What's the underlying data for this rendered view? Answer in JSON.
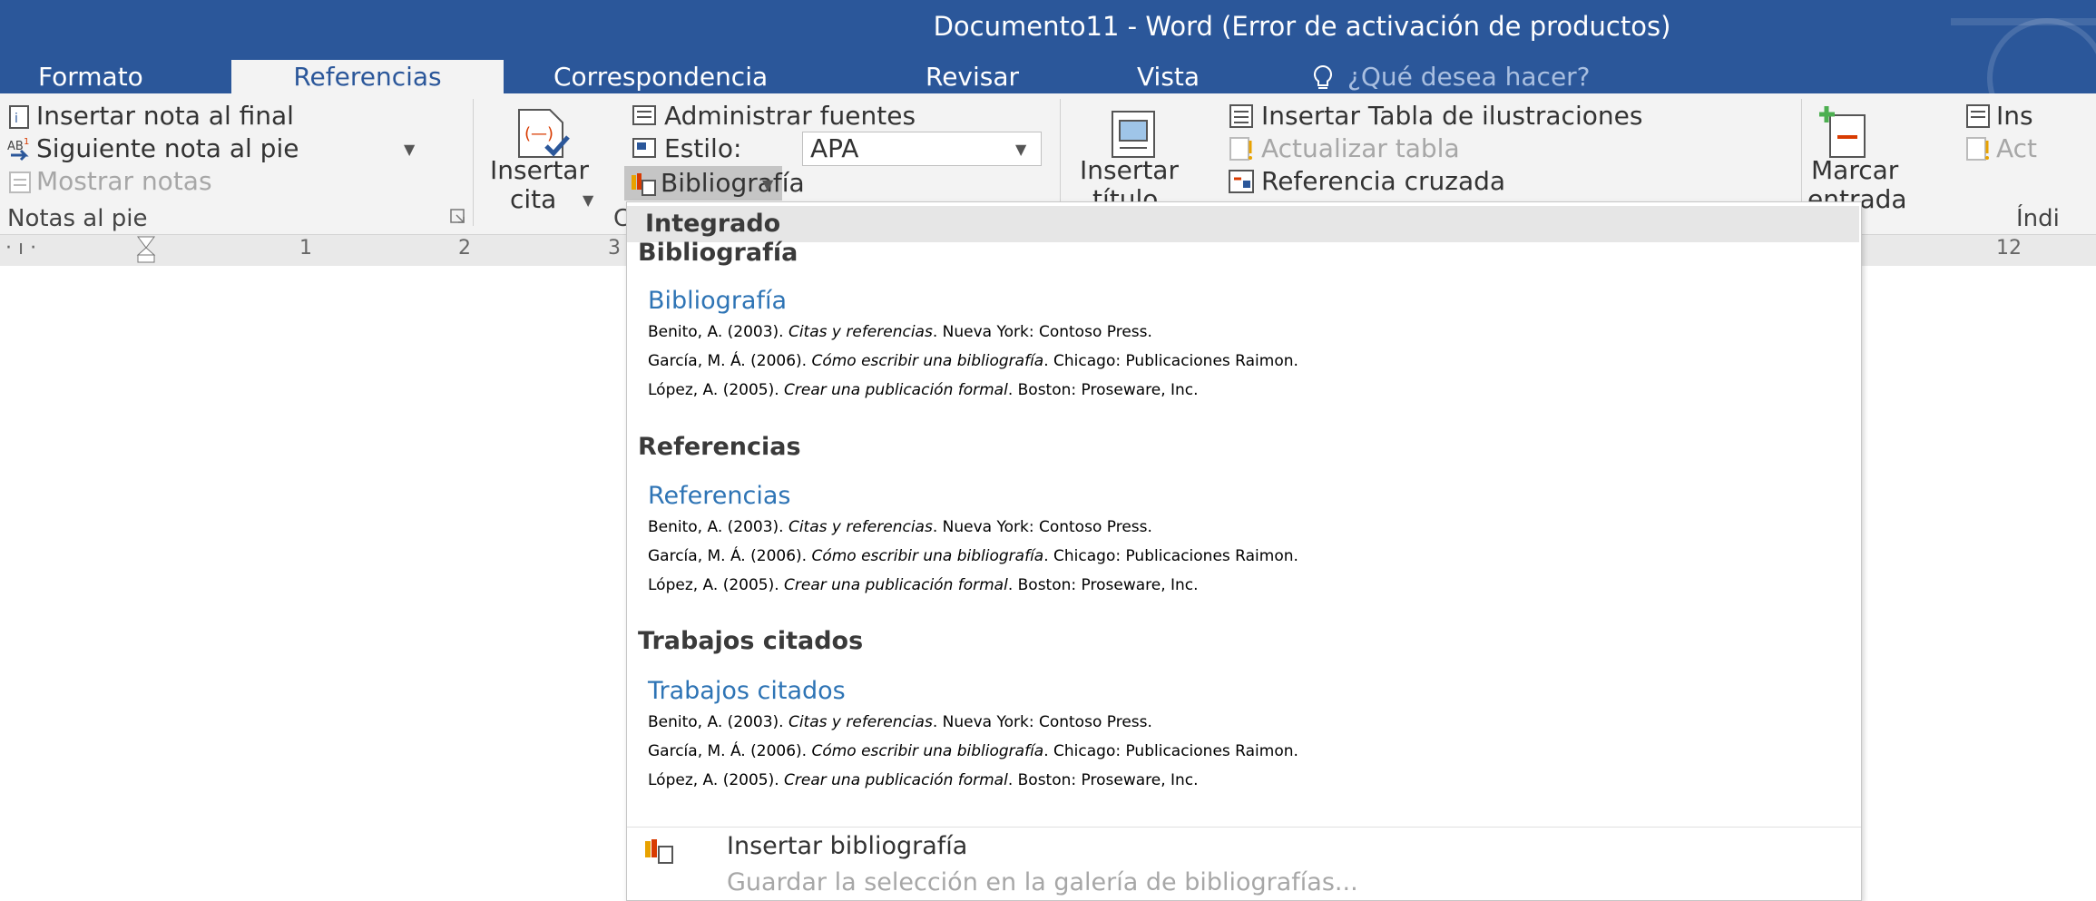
{
  "window": {
    "title": "Documento11 - Word (Error de activación de productos)"
  },
  "tabs": [
    "Formato",
    "Referencias",
    "Correspondencia",
    "Revisar",
    "Vista"
  ],
  "tell_me": "¿Qué desea hacer?",
  "ribbon": {
    "footnotes": {
      "insert_endnote": "Insertar nota al final",
      "next_footnote": "Siguiente nota al pie",
      "show_notes": "Mostrar notas",
      "group_label": "Notas al pie"
    },
    "citations": {
      "insert_citation_line1": "Insertar",
      "insert_citation_line2": "cita",
      "manage_sources": "Administrar fuentes",
      "style_label": "Estilo:",
      "style_value": "APA",
      "bibliography": "Bibliografía",
      "group_label_partial": "C"
    },
    "captions": {
      "insert_caption_line1": "Insertar",
      "insert_caption_line2": "título",
      "insert_table_figures": "Insertar Tabla de ilustraciones",
      "update_table": "Actualizar tabla",
      "cross_reference": "Referencia cruzada"
    },
    "index": {
      "mark_entry_line1": "Marcar",
      "mark_entry_line2": "entrada",
      "insert_partial": "Ins",
      "update_partial": "Act",
      "group_label_partial": "Índi"
    }
  },
  "ruler": {
    "left_marks": "· ı · ",
    "labels_left": [
      "1",
      "2",
      "3"
    ],
    "label_right": "12"
  },
  "dropdown": {
    "header": "Integrado",
    "sections": [
      {
        "section_title": "Bibliografía",
        "thumb_title": "Bibliografía",
        "entries": [
          {
            "before": "Benito, A. (2003). ",
            "italic": "Citas y referencias",
            "after": ". Nueva York: Contoso Press."
          },
          {
            "before": "García, M. Á. (2006). ",
            "italic": "Cómo escribir una bibliografía",
            "after": ". Chicago: Publicaciones Raimon."
          },
          {
            "before": "López, A. (2005). ",
            "italic": "Crear una publicación formal",
            "after": ". Boston: Proseware, Inc."
          }
        ]
      },
      {
        "section_title": "Referencias",
        "thumb_title": "Referencias",
        "entries": [
          {
            "before": "Benito, A. (2003). ",
            "italic": "Citas y referencias",
            "after": ". Nueva York: Contoso Press."
          },
          {
            "before": "García, M. Á. (2006). ",
            "italic": "Cómo escribir una bibliografía",
            "after": ". Chicago: Publicaciones Raimon."
          },
          {
            "before": "López, A. (2005). ",
            "italic": "Crear una publicación formal",
            "after": ". Boston: Proseware, Inc."
          }
        ]
      },
      {
        "section_title": "Trabajos citados",
        "thumb_title": "Trabajos citados",
        "entries": [
          {
            "before": "Benito, A. (2003). ",
            "italic": "Citas y referencias",
            "after": ". Nueva York: Contoso Press."
          },
          {
            "before": "García, M. Á. (2006). ",
            "italic": "Cómo escribir una bibliografía",
            "after": ". Chicago: Publicaciones Raimon."
          },
          {
            "before": "López, A. (2005). ",
            "italic": "Crear una publicación formal",
            "after": ". Boston: Proseware, Inc."
          }
        ]
      }
    ],
    "insert_bibliography": "Insertar bibliografía",
    "save_selection": "Guardar la selección en la galería de bibliografías..."
  },
  "colors": {
    "title_bar": "#2b579a",
    "ribbon_bg": "#f3f3f3",
    "link_blue": "#2e74b5",
    "accent_red": "#d83b01",
    "accent_green": "#4caf50"
  }
}
